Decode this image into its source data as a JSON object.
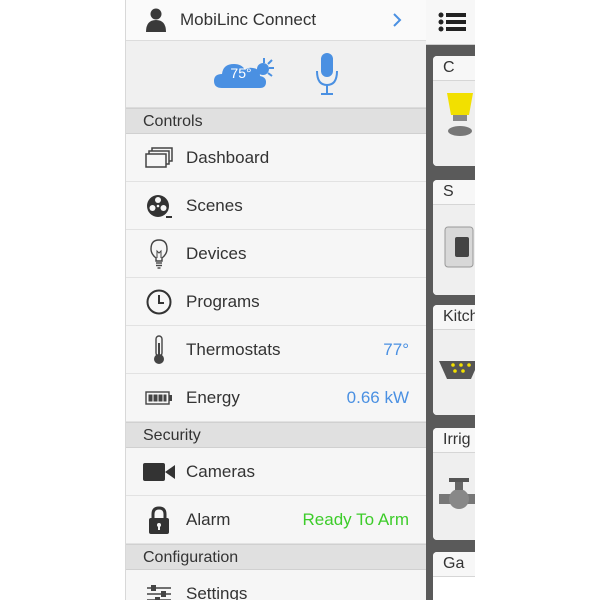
{
  "menu": {
    "account": {
      "name": "MobiLinc Connect"
    },
    "weather": {
      "temp": "75°"
    },
    "sections": [
      {
        "title": "Controls",
        "items": [
          {
            "label": "Dashboard",
            "value": ""
          },
          {
            "label": "Scenes",
            "value": ""
          },
          {
            "label": "Devices",
            "value": ""
          },
          {
            "label": "Programs",
            "value": ""
          },
          {
            "label": "Thermostats",
            "value": "77°"
          },
          {
            "label": "Energy",
            "value": "0.66 kW"
          }
        ]
      },
      {
        "title": "Security",
        "items": [
          {
            "label": "Cameras",
            "value": ""
          },
          {
            "label": "Alarm",
            "value": "Ready To Arm"
          }
        ]
      },
      {
        "title": "Configuration",
        "items": [
          {
            "label": "Settings",
            "value": ""
          }
        ]
      }
    ]
  },
  "content": {
    "cards": [
      {
        "title": "C"
      },
      {
        "title": "S"
      },
      {
        "title": "Kitch"
      },
      {
        "title": "Irrig"
      },
      {
        "title": "Ga"
      }
    ]
  },
  "colors": {
    "accent": "#4a90e2",
    "ready": "#3dcc2a",
    "section_bg": "#e0e0e0",
    "content_bg": "#5a5a5a"
  }
}
